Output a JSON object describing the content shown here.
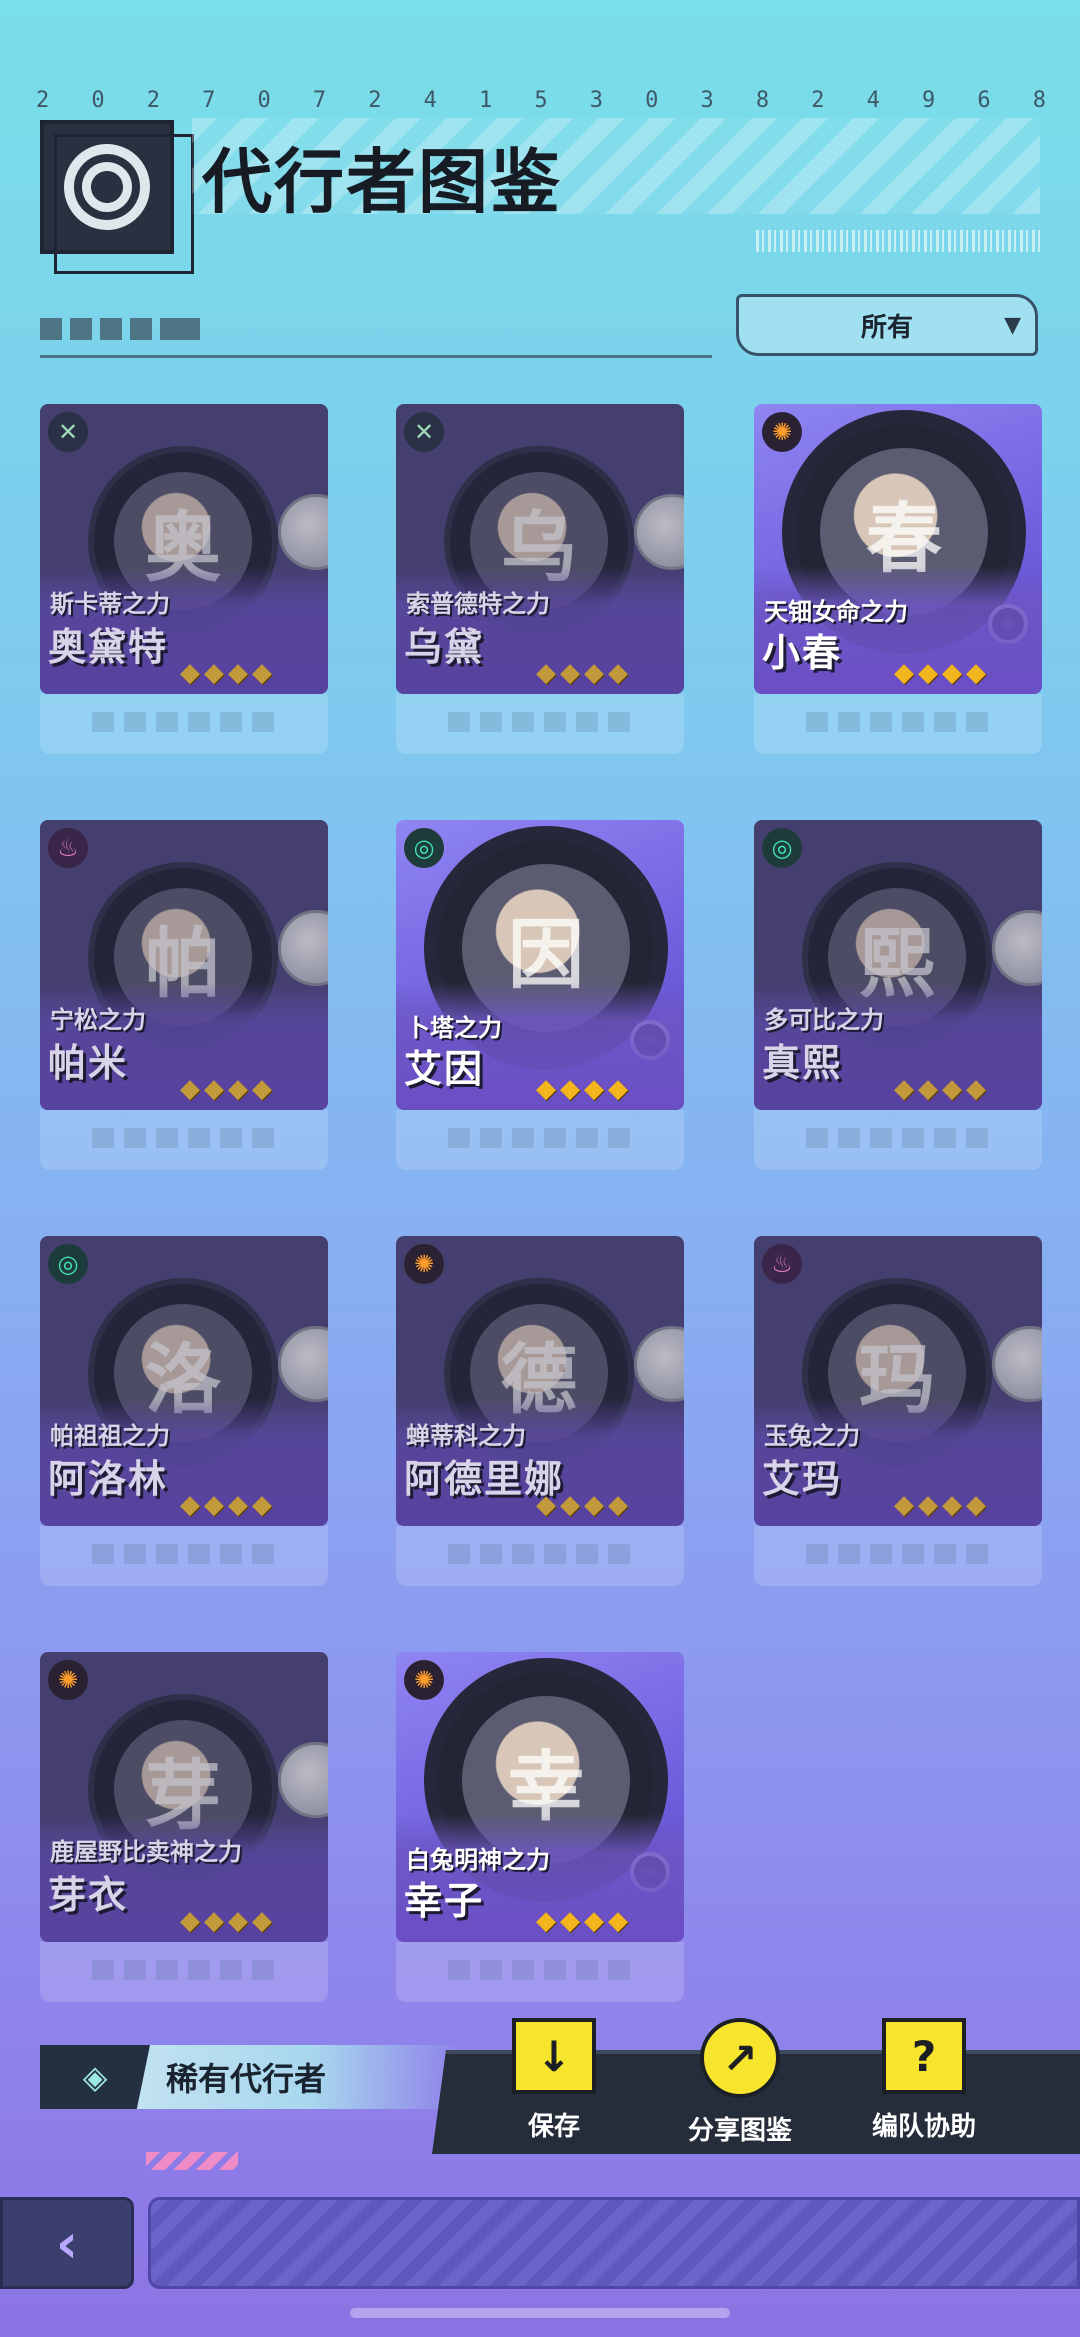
{
  "header": {
    "serial_digits": [
      "2",
      "0",
      "2",
      "7",
      "0",
      "7",
      "2",
      "4",
      "1",
      "5",
      "3",
      "0",
      "3",
      "8",
      "2",
      "4",
      "9",
      "6",
      "8"
    ],
    "title": "代行者图鉴"
  },
  "filter": {
    "selected": "所有",
    "caret": "▼"
  },
  "agents": [
    {
      "power": "斯卡蒂之力",
      "name": "奥黛特",
      "stars": 4,
      "element_icon": "x-icon",
      "glyph": "✕",
      "owned": false,
      "portrait_initial": "奥"
    },
    {
      "power": "索普德特之力",
      "name": "乌黛",
      "stars": 4,
      "element_icon": "x-icon",
      "glyph": "✕",
      "owned": false,
      "portrait_initial": "乌"
    },
    {
      "power": "天钿女命之力",
      "name": "小春",
      "stars": 4,
      "element_icon": "sun-icon",
      "glyph": "✺",
      "owned": true,
      "portrait_initial": "春"
    },
    {
      "power": "宁松之力",
      "name": "帕米",
      "stars": 4,
      "element_icon": "pink-flame-icon",
      "glyph": "♨",
      "owned": false,
      "portrait_initial": "帕"
    },
    {
      "power": "卜塔之力",
      "name": "艾因",
      "stars": 4,
      "element_icon": "spiral-icon",
      "glyph": "◎",
      "owned": true,
      "portrait_initial": "因"
    },
    {
      "power": "多可比之力",
      "name": "真熙",
      "stars": 4,
      "element_icon": "spiral-icon",
      "glyph": "◎",
      "owned": false,
      "portrait_initial": "熙"
    },
    {
      "power": "帕祖祖之力",
      "name": "阿洛林",
      "stars": 4,
      "element_icon": "spiral-icon",
      "glyph": "◎",
      "owned": false,
      "portrait_initial": "洛"
    },
    {
      "power": "蝉蒂科之力",
      "name": "阿德里娜",
      "stars": 4,
      "element_icon": "sun-icon",
      "glyph": "✺",
      "owned": false,
      "portrait_initial": "德"
    },
    {
      "power": "玉兔之力",
      "name": "艾玛",
      "stars": 4,
      "element_icon": "pink-flame-icon",
      "glyph": "♨",
      "owned": false,
      "portrait_initial": "玛"
    },
    {
      "power": "鹿屋野比卖神之力",
      "name": "芽衣",
      "stars": 4,
      "element_icon": "sun-icon",
      "glyph": "✺",
      "owned": false,
      "portrait_initial": "芽"
    },
    {
      "power": "白兔明神之力",
      "name": "幸子",
      "stars": 4,
      "element_icon": "sun-icon",
      "glyph": "✺",
      "owned": true,
      "portrait_initial": "幸"
    }
  ],
  "rare_section": {
    "label": "稀有代行者",
    "icon": "eye-emblem-icon",
    "glyph": "◈"
  },
  "actions": [
    {
      "label": "保存",
      "icon": "folder-download-icon",
      "glyph": "↓"
    },
    {
      "label": "分享图鉴",
      "icon": "share-disc-icon",
      "glyph": "↗"
    },
    {
      "label": "编队协助",
      "icon": "cards-icon",
      "glyph": "?"
    }
  ],
  "nav": {
    "back_glyph": "‹"
  },
  "colors": {
    "accent_yellow": "#f6e52c",
    "star_gold": "#f3b51d",
    "card_purple": "#6a4fc4",
    "background_top": "#79dfe8",
    "background_bottom": "#8b73e3"
  }
}
